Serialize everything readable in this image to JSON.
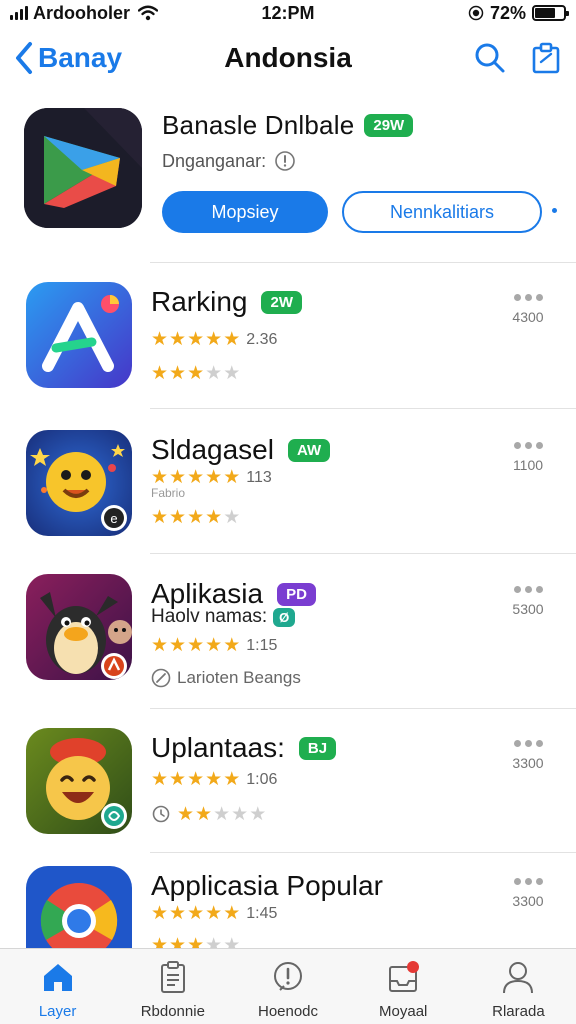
{
  "status_bar": {
    "carrier": "Ardooholer",
    "time": "12:PM",
    "battery_percent": "72%",
    "battery_level": 0.72
  },
  "nav": {
    "back_label": "Banay",
    "title": "Andonsia"
  },
  "featured": {
    "title": "Banasle Dnlbale",
    "badge": "29W",
    "badge_color": "#1fae4f",
    "subtitle": "Dnganganar:",
    "primary_button": "Mopsiey",
    "secondary_button": "Nennkalitiars"
  },
  "apps": [
    {
      "title": "Rarking",
      "badge": "2W",
      "badge_color": "#1fae4f",
      "rating_count": "2.36",
      "rating": 4.5,
      "second_rating": 3,
      "count": "4300",
      "icon": "app-icon-blue-arrow"
    },
    {
      "title": "Sldagasel",
      "badge": "AW",
      "badge_color": "#1fae4f",
      "rating_count": "113",
      "rating": 4.5,
      "small_text": "Fabrio",
      "second_rating": 4,
      "count": "1100",
      "icon": "app-icon-smiley-game"
    },
    {
      "title": "Aplikasia",
      "badge": "PD",
      "badge_color": "#7a3dd1",
      "subtitle": "Haolv namas:",
      "subtitle_badge": "Ø",
      "subtitle_badge_color": "#1fa88f",
      "rating_count": "1:15",
      "rating": 4.5,
      "developer": "Larioten Beangs",
      "count": "5300",
      "icon": "app-icon-penguin-character"
    },
    {
      "title": "Uplantaas:",
      "badge": "BJ",
      "badge_color": "#1fae4f",
      "rating_count": "1:06",
      "rating": 4.5,
      "second_rating": 2,
      "count": "3300",
      "icon": "app-icon-happy-character"
    },
    {
      "title": "Applicasia Popular",
      "rating_count": "1:45",
      "rating": 4.5,
      "second_rating": 3,
      "count": "3300",
      "icon": "app-icon-chrome-like"
    }
  ],
  "tabs": [
    {
      "label": "Layer",
      "icon": "home-icon",
      "active": true
    },
    {
      "label": "Rbdonnie",
      "icon": "clipboard-icon",
      "active": false
    },
    {
      "label": "Hoenodc",
      "icon": "info-circle-icon",
      "active": false
    },
    {
      "label": "Moyaal",
      "icon": "inbox-notification-icon",
      "active": false
    },
    {
      "label": "Rlarada",
      "icon": "person-icon",
      "active": false
    }
  ],
  "colors": {
    "accent": "#1a7ae8",
    "star": "#f2a91a"
  }
}
